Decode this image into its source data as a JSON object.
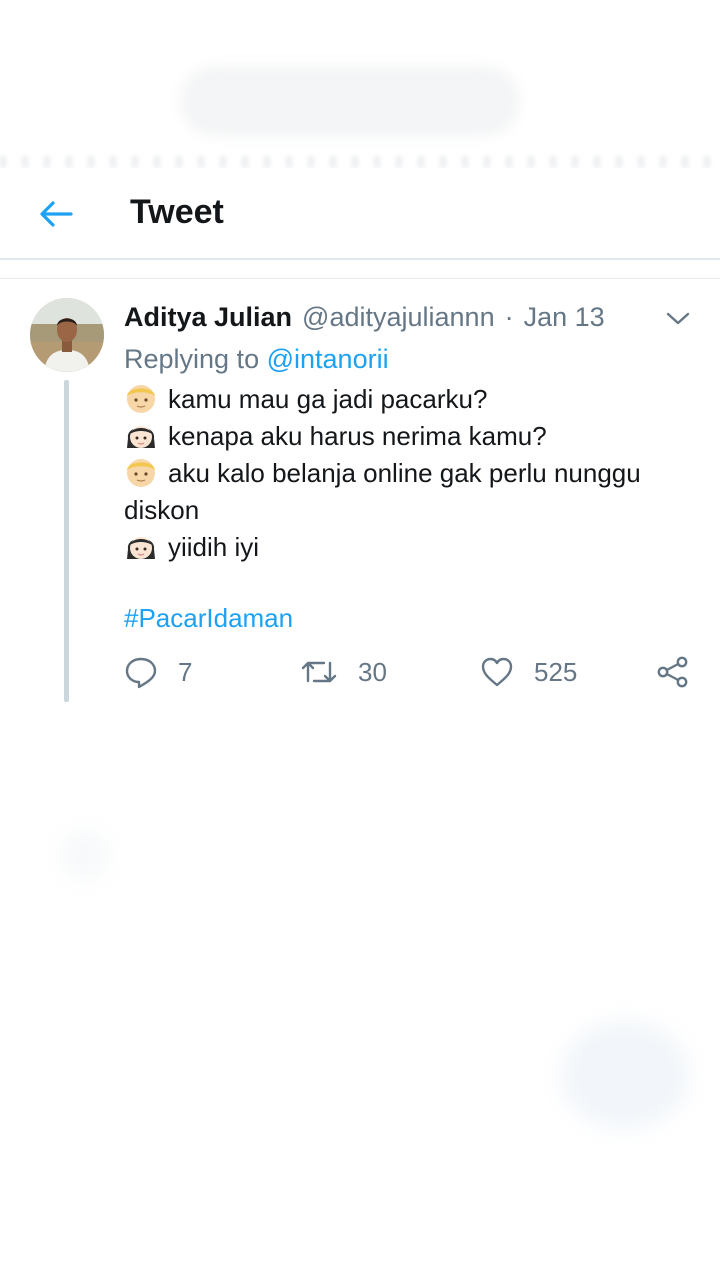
{
  "header": {
    "title": "Tweet",
    "back_icon": "arrow-left-icon"
  },
  "tweet": {
    "author_name": "Aditya Julian",
    "handle": "@adityajuliannn",
    "separator": "·",
    "date": "Jan 13",
    "replying_label": "Replying to",
    "replying_to": "@intanorii",
    "lines": [
      {
        "emoji": "boy-face-icon",
        "text": "kamu mau ga jadi pacarku?"
      },
      {
        "emoji": "girl-face-icon",
        "text": "kenapa aku harus nerima kamu?"
      },
      {
        "emoji": "boy-face-icon",
        "text": "aku kalo belanja online gak perlu nunggu diskon"
      },
      {
        "emoji": "girl-face-icon",
        "text": "yiidih iyi"
      }
    ],
    "hashtag": "#PacarIdaman"
  },
  "actions": {
    "replies": "7",
    "retweets": "30",
    "likes": "525"
  },
  "colors": {
    "accent": "#1da1f2",
    "secondary_text": "#657786",
    "divider": "#e1e8ed"
  }
}
